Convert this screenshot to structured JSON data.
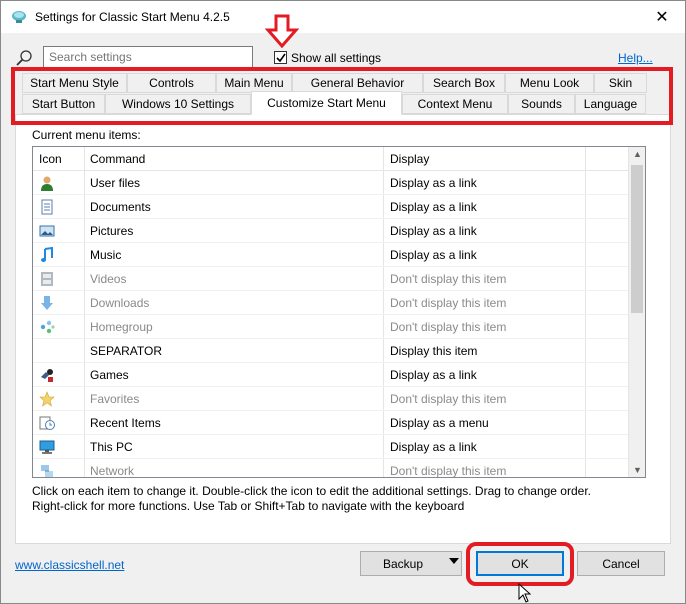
{
  "window": {
    "title": "Settings for Classic Start Menu 4.2.5",
    "close_glyph": "✕"
  },
  "toolbar": {
    "search_placeholder": "Search settings",
    "show_all_label": "Show all settings",
    "show_all_checked": true,
    "help_label": "Help..."
  },
  "tabs": {
    "row1": [
      "Start Menu Style",
      "Controls",
      "Main Menu",
      "General Behavior",
      "Search Box",
      "Menu Look",
      "Skin"
    ],
    "row2": [
      "Start Button",
      "Windows 10 Settings",
      "Customize Start Menu",
      "Context Menu",
      "Sounds",
      "Language"
    ],
    "active": "Customize Start Menu"
  },
  "panel": {
    "caption": "Current menu items:",
    "columns": [
      "Icon",
      "Command",
      "Display"
    ],
    "rows": [
      {
        "icon": "user-files-icon",
        "command": "User files",
        "display": "Display as a link",
        "dim": false
      },
      {
        "icon": "documents-icon",
        "command": "Documents",
        "display": "Display as a link",
        "dim": false
      },
      {
        "icon": "pictures-icon",
        "command": "Pictures",
        "display": "Display as a link",
        "dim": false
      },
      {
        "icon": "music-icon",
        "command": "Music",
        "display": "Display as a link",
        "dim": false
      },
      {
        "icon": "videos-icon",
        "command": "Videos",
        "display": "Don't display this item",
        "dim": true
      },
      {
        "icon": "downloads-icon",
        "command": "Downloads",
        "display": "Don't display this item",
        "dim": true
      },
      {
        "icon": "homegroup-icon",
        "command": "Homegroup",
        "display": "Don't display this item",
        "dim": true
      },
      {
        "icon": "",
        "command": "SEPARATOR",
        "display": "Display this item",
        "dim": false
      },
      {
        "icon": "games-icon",
        "command": "Games",
        "display": "Display as a link",
        "dim": false
      },
      {
        "icon": "favorites-icon",
        "command": "Favorites",
        "display": "Don't display this item",
        "dim": true
      },
      {
        "icon": "recent-items-icon",
        "command": "Recent Items",
        "display": "Display as a menu",
        "dim": false
      },
      {
        "icon": "this-pc-icon",
        "command": "This PC",
        "display": "Display as a link",
        "dim": false
      },
      {
        "icon": "network-icon",
        "command": "Network",
        "display": "Don't display this item",
        "dim": true
      }
    ],
    "hint_line1": "Click on each item to change it. Double-click the icon to edit the additional settings. Drag to change order.",
    "hint_line2": "Right-click for more functions. Use Tab or Shift+Tab to navigate with the keyboard"
  },
  "footer": {
    "site_link": "www.classicshell.net",
    "backup_label": "Backup",
    "ok_label": "OK",
    "cancel_label": "Cancel"
  },
  "annotation_color": "#e31b23"
}
